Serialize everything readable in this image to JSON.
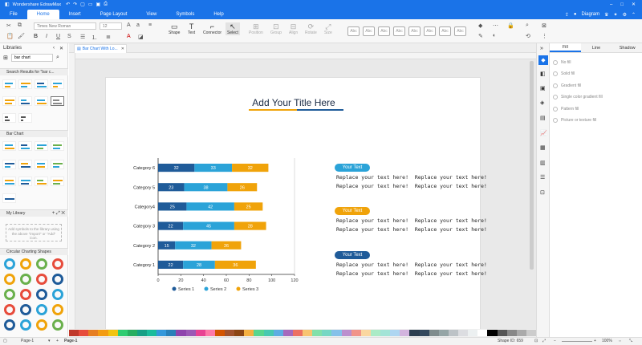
{
  "app": {
    "title": "Wondershare EdrawMax"
  },
  "menu": {
    "tabs": [
      "File",
      "Home",
      "Insert",
      "Page Layout",
      "View",
      "Symbols",
      "Help"
    ],
    "active": 1
  },
  "topright": {
    "diagram": "Diagram"
  },
  "ribbon": {
    "font": "Times New Roman",
    "size": "12",
    "buttons": [
      "Shape",
      "Text",
      "Connector",
      "Select",
      "Position",
      "Group",
      "Align",
      "Rotate",
      "Size"
    ],
    "style_label": "Abc"
  },
  "libraries": {
    "title": "Libraries",
    "search_value": "bar chart",
    "search_results": "Search Results for \"bar c...",
    "bar_chart": "Bar Chart",
    "my_library": "My Library",
    "my_library_hint": "Add symbols to the library using the above \"import\" or \"Add\" icon.",
    "circular": "Circular Charting Shapes"
  },
  "doc": {
    "tab": "Bar Chart With Lo..."
  },
  "page": {
    "title": "Add Your Title Here"
  },
  "chart_data": {
    "type": "bar",
    "orientation": "horizontal",
    "stacked": true,
    "categories": [
      "Category 1",
      "Category 2",
      "Category 3",
      "Category4",
      "Category 5",
      "Category 6"
    ],
    "series": [
      {
        "name": "Series 1",
        "values": [
          22,
          15,
          22,
          25,
          23,
          32
        ],
        "color": "#1f5b99"
      },
      {
        "name": "Series 2",
        "values": [
          28,
          32,
          45,
          42,
          38,
          33
        ],
        "color": "#2ba3d8"
      },
      {
        "name": "Series 3",
        "values": [
          36,
          26,
          28,
          25,
          26,
          32
        ],
        "color": "#f0a30a"
      }
    ],
    "x_ticks": [
      0,
      20,
      40,
      60,
      80,
      100,
      120
    ],
    "xlim": [
      0,
      120
    ],
    "legend": "bottom"
  },
  "textblocks": [
    {
      "badge": "Your Text",
      "color": "#2ba3d8",
      "lines": [
        "Replace your text here!  Replace your text here!",
        "Replace your text here!  Replace your text here!"
      ]
    },
    {
      "badge": "Your Text",
      "color": "#f0a30a",
      "lines": [
        "Replace your text here!  Replace your text here!",
        "Replace your text here!  Replace your text here!"
      ]
    },
    {
      "badge": "Your Text",
      "color": "#1f5b99",
      "lines": [
        "Replace your text here!  Replace your text here!",
        "Replace your text here!  Replace your text here!"
      ]
    }
  ],
  "rightpanel": {
    "tabs": [
      "Fill",
      "Line",
      "Shadow"
    ],
    "options": [
      "No fill",
      "Solid fill",
      "Gradient fill",
      "Single color gradient fill",
      "Pattern fill",
      "Picture or texture fill"
    ]
  },
  "status": {
    "page_select": "Page-1",
    "page_tab": "Page-1",
    "shape_id": "Shape ID: 659",
    "zoom": "100%"
  }
}
